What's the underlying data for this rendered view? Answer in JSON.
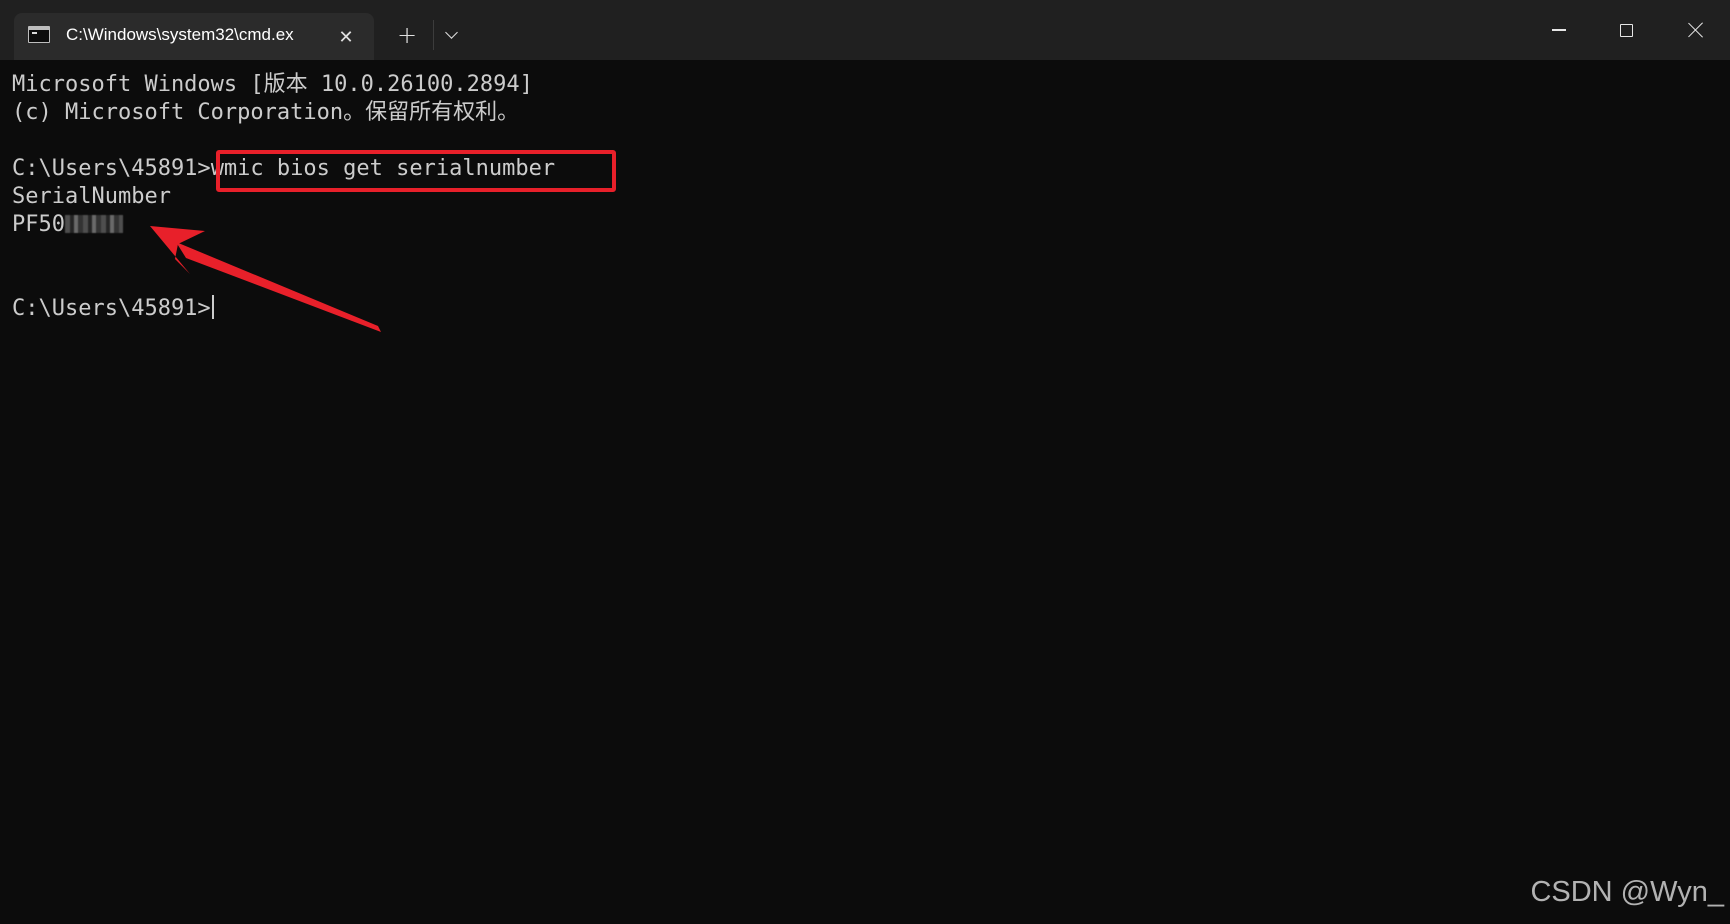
{
  "window": {
    "tab_title": "C:\\Windows\\system32\\cmd.ex",
    "tab_close_glyph": "✕",
    "new_tab_glyph": "+"
  },
  "terminal": {
    "line1": "Microsoft Windows [版本 10.0.26100.2894]",
    "line2": "(c) Microsoft Corporation。保留所有权利。",
    "prompt1": "C:\\Users\\45891>",
    "command": "wmic bios get serialnumber",
    "output_header": "SerialNumber",
    "serial_visible": "PF50",
    "prompt2": "C:\\Users\\45891>"
  },
  "annotations": {
    "highlight_color": "#e8202a",
    "arrow_color": "#e8202a"
  },
  "watermark": "CSDN @Wyn_"
}
